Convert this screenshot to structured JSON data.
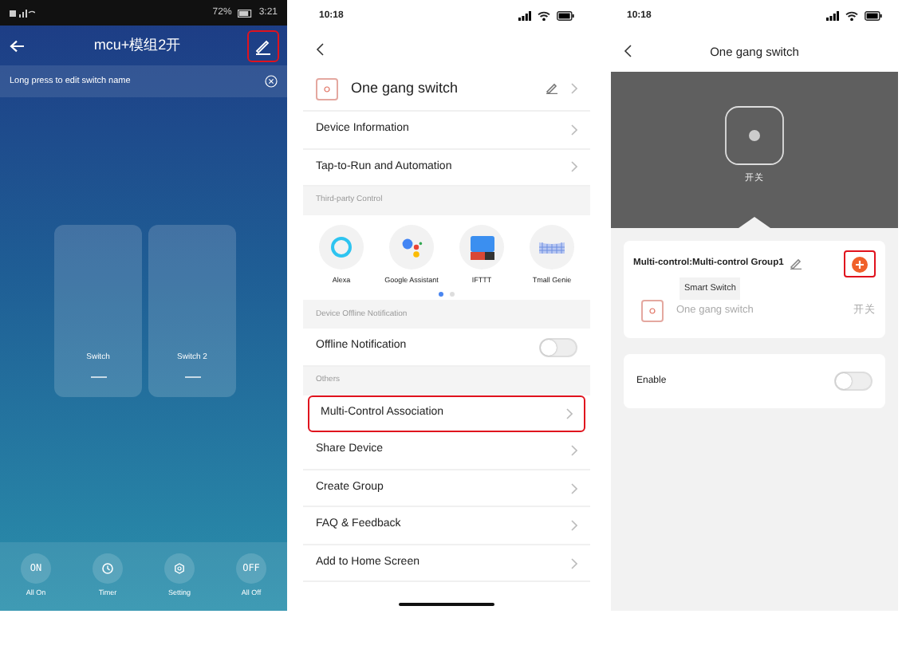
{
  "light_screen": {
    "status_bar": {
      "battery": "72%",
      "time": "3:21"
    },
    "title": "mcu+模组2开",
    "edit_highlighted": true,
    "hint": "Long press to edit switch name",
    "switches": [
      {
        "label": "Switch"
      },
      {
        "label": "Switch 2"
      }
    ],
    "actions": [
      {
        "kind": "text",
        "glyph": "ON",
        "label": "All On"
      },
      {
        "kind": "timer",
        "label": "Timer"
      },
      {
        "kind": "setting",
        "label": "Setting"
      },
      {
        "kind": "text",
        "glyph": "OFF",
        "label": "All Off"
      }
    ]
  },
  "settings_screen": {
    "time": "10:18",
    "device_name": "One gang switch",
    "items": [
      {
        "kind": "row",
        "label": "Device Information",
        "highlighted": false
      },
      {
        "kind": "row",
        "label": "Tap-to-Run and Automation",
        "highlighted": false
      },
      {
        "kind": "header",
        "label": "Third-party Control"
      },
      {
        "kind": "integrations",
        "services": [
          {
            "kind": "ring",
            "name": "Alexa"
          },
          {
            "kind": "dots",
            "name": "Google Assistant"
          },
          {
            "kind": "tile",
            "name": "IFTTT"
          },
          {
            "kind": "grid",
            "name": "Tmall Genie"
          }
        ],
        "pages": [
          {
            "selected": true
          },
          {
            "selected": false
          }
        ]
      },
      {
        "kind": "header",
        "label": "Device Offline Notification"
      },
      {
        "kind": "toggle",
        "label": "Offline Notification",
        "on": false
      },
      {
        "kind": "header",
        "label": "Others"
      },
      {
        "kind": "row",
        "label": "Multi-Control Association",
        "highlighted": true
      },
      {
        "kind": "row",
        "label": "Share Device",
        "highlighted": false
      },
      {
        "kind": "row",
        "label": "Create Group",
        "highlighted": false
      },
      {
        "kind": "row",
        "label": "FAQ & Feedback",
        "highlighted": false
      },
      {
        "kind": "row",
        "label": "Add to Home Screen",
        "highlighted": false
      }
    ]
  },
  "group_screen": {
    "time": "10:18",
    "title": "One gang switch",
    "device_label": "开关",
    "group": {
      "title": "Multi-control:Multi-control Group1",
      "add_highlighted": true,
      "tooltip": "Smart Switch",
      "device": {
        "name": "One gang switch",
        "channel": "开关"
      }
    },
    "enable": {
      "label": "Enable",
      "on": false
    }
  }
}
